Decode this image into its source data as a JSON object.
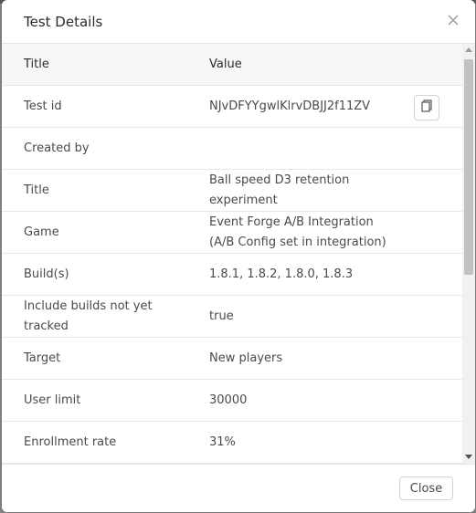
{
  "dialog": {
    "title": "Test Details",
    "close_button_label": "Close"
  },
  "table": {
    "headers": {
      "title": "Title",
      "value": "Value"
    },
    "rows": [
      {
        "title": "Test id",
        "value": "NJvDFYYgwlKlrvDBJJ2f11ZV",
        "has_copy": true
      },
      {
        "title": "Created by",
        "value": ""
      },
      {
        "title": "Title",
        "value": "Ball speed D3 retention experiment"
      },
      {
        "title": "Game",
        "value": "Event Forge A/B Integration (A/B Config set in integration)"
      },
      {
        "title": "Build(s)",
        "value": "1.8.1, 1.8.2, 1.8.0, 1.8.3"
      },
      {
        "title": "Include builds not yet tracked",
        "value": "true"
      },
      {
        "title": "Target",
        "value": "New players"
      },
      {
        "title": "User limit",
        "value": "30000"
      },
      {
        "title": "Enrollment rate",
        "value": "31%"
      }
    ]
  },
  "icons": {
    "close": "close-icon",
    "copy": "copy-icon"
  }
}
